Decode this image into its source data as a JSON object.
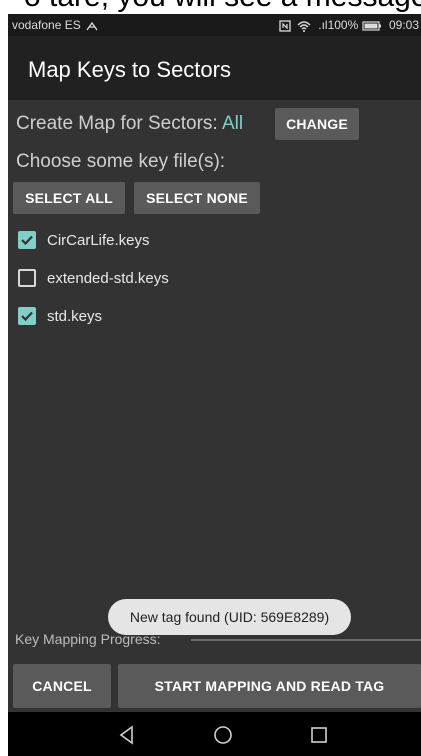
{
  "caption_fragment": "o tare, you will see a message",
  "status_bar": {
    "carrier": "vodafone ES",
    "signal_text": ".ıl",
    "battery_percent": "100%",
    "time": "09:03"
  },
  "app_bar": {
    "title": "Map Keys to Sectors"
  },
  "sectors": {
    "label": "Create Map for Sectors:",
    "value": "All",
    "change_button": "CHANGE"
  },
  "files": {
    "choose_label": "Choose some key file(s):",
    "select_all_button": "SELECT ALL",
    "select_none_button": "SELECT NONE",
    "items": [
      {
        "name": "CirCarLife.keys",
        "checked": true
      },
      {
        "name": "extended-std.keys",
        "checked": false
      },
      {
        "name": "std.keys",
        "checked": true
      }
    ]
  },
  "toast": {
    "message": "New tag found (UID: 569E8289)"
  },
  "progress": {
    "label": "Key Mapping Progress:",
    "value": 0
  },
  "actions": {
    "cancel_button": "CANCEL",
    "start_button": "START MAPPING AND READ TAG"
  },
  "colors": {
    "accent": "#7fd1c8",
    "content_background": "#333333",
    "app_bar_background": "#212121",
    "button_background": "#5a5a5a"
  }
}
